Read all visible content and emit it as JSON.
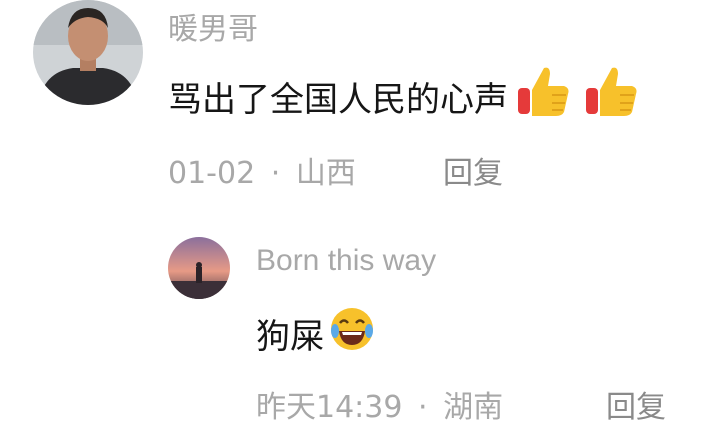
{
  "comments": [
    {
      "username": "暖男哥",
      "text": "骂出了全国人民的心声",
      "emojis": [
        "thumbs-up-icon",
        "thumbs-up-icon"
      ],
      "date": "01-02",
      "separator": "·",
      "location": "山西",
      "reply_label": "回复"
    }
  ],
  "replies": [
    {
      "username": "Born this way",
      "text": "狗屎",
      "emojis": [
        "laughing-tears-icon"
      ],
      "date": "昨天14:39",
      "separator": "·",
      "location": "湖南",
      "reply_label": "回复"
    }
  ],
  "colors": {
    "text": "#161616",
    "muted": "#a8a8a8",
    "emoji_yellow": "#f7c12b",
    "emoji_red": "#e53a3a"
  }
}
